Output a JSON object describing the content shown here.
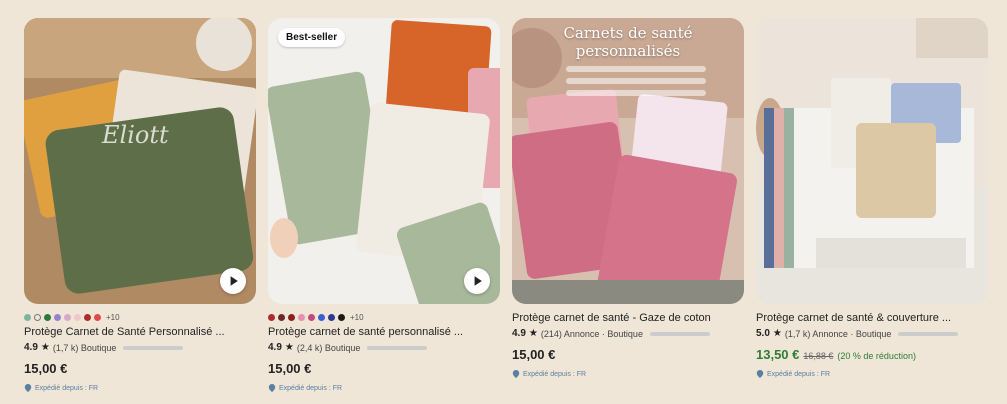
{
  "colors": {
    "accent_green": "#2e7d32",
    "bg": "#efe6d8"
  },
  "products": [
    {
      "badge": "",
      "has_video": true,
      "swatches": [
        "#7fb3a0",
        "outline",
        "#2a7a3a",
        "#9b7fd0",
        "#d7a9c8",
        "#f0c8c8",
        "#b02a2a",
        "#e04a4a"
      ],
      "more_colors": "+10",
      "title": "Protège Carnet de Santé Personnalisé ...",
      "rating": "4.9",
      "reviews": "(1,7 k) Boutique",
      "price": "15,00 €",
      "ship": "Expédié depuis : FR"
    },
    {
      "badge": "Best-seller",
      "has_video": true,
      "swatches": [
        "#b02a2a",
        "#6b2a2a",
        "#8a1f1f",
        "#e88fb0",
        "#c04a7a",
        "#3a5fd0",
        "#2a3a90",
        "#1a1a1a"
      ],
      "more_colors": "+10",
      "title": "Protège carnet de santé personnalisé ...",
      "rating": "4.9",
      "reviews": "(2,4 k) Boutique",
      "price": "15,00 €",
      "ship": "Expédié depuis : FR"
    },
    {
      "badge": "",
      "has_video": false,
      "overlay": "Carnets de santé personnalisés",
      "title": "Protège carnet de santé - Gaze de coton",
      "rating": "4.9",
      "reviews": "(214) Annonce · Boutique",
      "price": "15,00 €",
      "ship": "Expédié depuis : FR"
    },
    {
      "badge": "",
      "has_video": false,
      "title": "Protège carnet de santé & couverture ...",
      "rating": "5.0",
      "reviews": "(1,7 k) Annonce · Boutique",
      "price_sale": "13,50 €",
      "price_old": "16,88 €",
      "discount": "(20 % de réduction)",
      "ship": "Expédié depuis : FR"
    }
  ]
}
